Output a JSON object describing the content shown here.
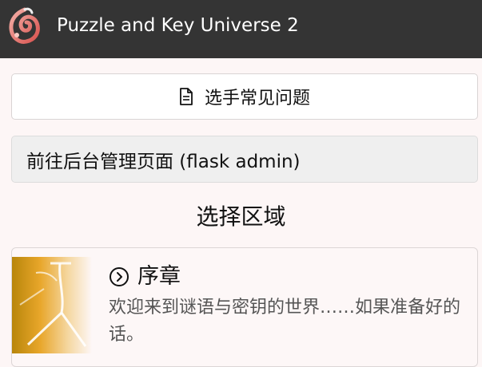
{
  "header": {
    "app_title": "Puzzle and Key Universe 2",
    "logo_icon": "spiral-logo-icon",
    "background": "#343434"
  },
  "faq_button": {
    "label": "选手常见问题",
    "icon": "document-icon"
  },
  "admin_button": {
    "label": "前往后台管理页面 (flask admin)"
  },
  "section": {
    "title": "选择区域"
  },
  "areas": [
    {
      "name": "序章",
      "icon": "chevron-right-circle-icon",
      "description": "欢迎来到谜语与密钥的世界……如果准备好的话。"
    }
  ]
}
